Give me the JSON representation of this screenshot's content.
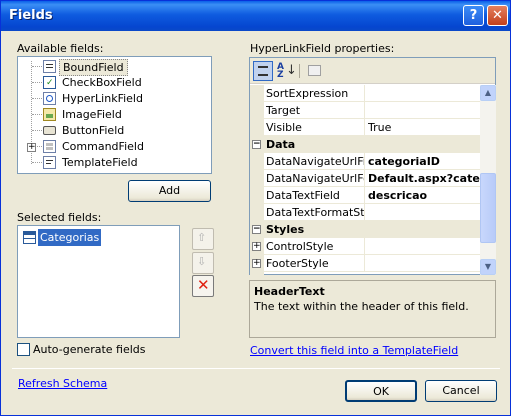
{
  "window": {
    "title": "Fields",
    "help_glyph": "?",
    "close_glyph": "✕"
  },
  "available": {
    "label": "Available fields:",
    "items": [
      {
        "label": "BoundField",
        "icon": "boundfield-icon"
      },
      {
        "label": "CheckBoxField",
        "icon": "checkboxfield-icon"
      },
      {
        "label": "HyperLinkField",
        "icon": "hyperlinkfield-icon"
      },
      {
        "label": "ImageField",
        "icon": "imagefield-icon"
      },
      {
        "label": "ButtonField",
        "icon": "buttonfield-icon"
      },
      {
        "label": "CommandField",
        "icon": "commandfield-icon"
      },
      {
        "label": "TemplateField",
        "icon": "templatefield-icon"
      }
    ],
    "add_label": "Add"
  },
  "selected": {
    "label": "Selected fields:",
    "items": [
      {
        "label": "Categorias",
        "icon": "table-icon"
      }
    ]
  },
  "properties": {
    "label": "HyperLinkField properties:",
    "rows_top": [
      {
        "name": "SortExpression",
        "value": ""
      },
      {
        "name": "Target",
        "value": ""
      },
      {
        "name": "Visible",
        "value": "True"
      }
    ],
    "cat_data": "Data",
    "rows_data": [
      {
        "name": "DataNavigateUrlFiel",
        "value": "categoriaID"
      },
      {
        "name": "DataNavigateUrlFor",
        "value": "Default.aspx?catego"
      },
      {
        "name": "DataTextField",
        "value": "descricao"
      },
      {
        "name": "DataTextFormatStri",
        "value": ""
      }
    ],
    "cat_styles": "Styles",
    "rows_styles": [
      {
        "name": "ControlStyle",
        "value": ""
      },
      {
        "name": "FooterStyle",
        "value": ""
      }
    ]
  },
  "description": {
    "title": "HeaderText",
    "text": "The text within the header of this field."
  },
  "convert_link": "Convert this field into a TemplateField",
  "autogen_label": "Auto-generate fields",
  "refresh_link": "Refresh Schema",
  "ok_label": "OK",
  "cancel_label": "Cancel"
}
